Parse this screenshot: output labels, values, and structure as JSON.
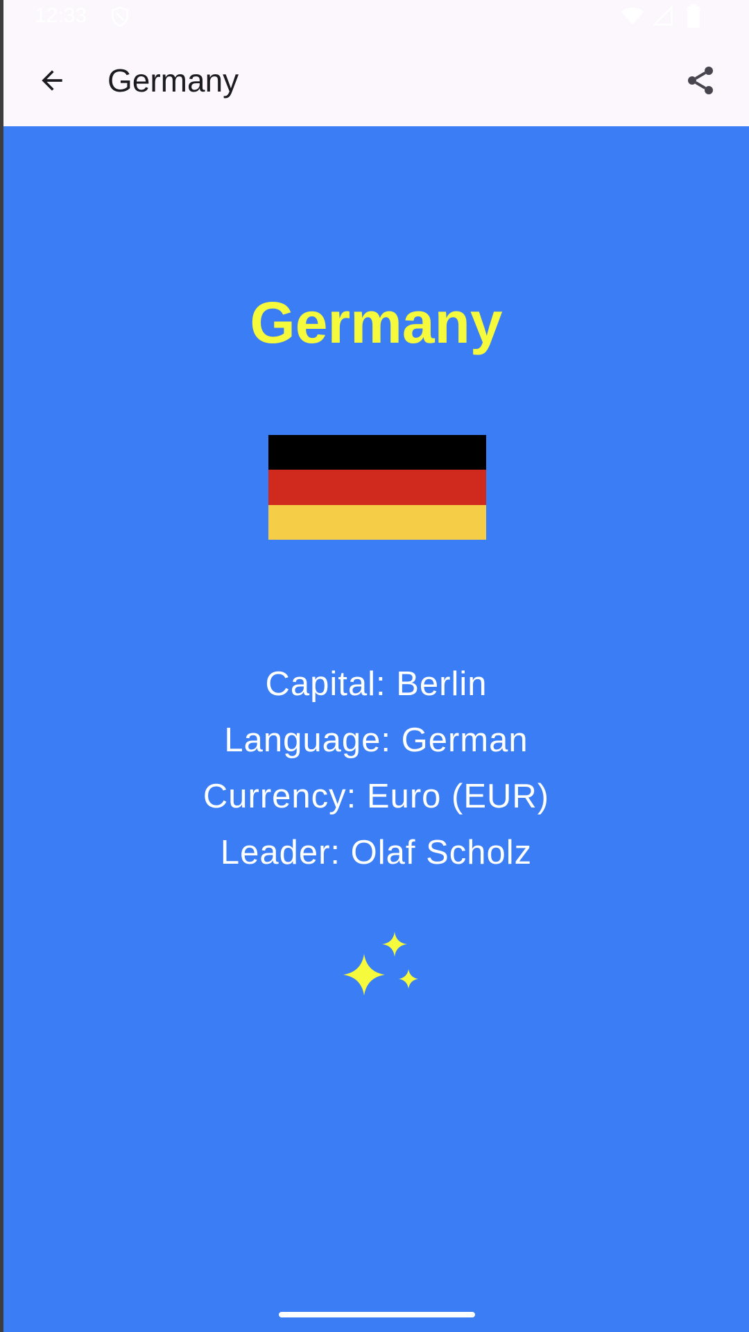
{
  "status_bar": {
    "time": "12:33",
    "icons": [
      "shield-icon",
      "wifi-icon",
      "signal-icon",
      "battery-icon"
    ]
  },
  "app_bar": {
    "back_icon": "arrow-back-icon",
    "title": "Germany",
    "share_icon": "share-icon"
  },
  "country": {
    "name": "Germany",
    "flag": {
      "stripes": [
        "#000000",
        "#cf2a1d",
        "#f6cd47"
      ]
    },
    "facts": {
      "capital": "Capital: Berlin",
      "language": "Language: German",
      "currency": "Currency: Euro (EUR)",
      "leader": "Leader: Olaf Scholz"
    },
    "decoration_icon": "sparkles-icon"
  },
  "colors": {
    "background": "#3a7df5",
    "heading": "#f6fa3c",
    "app_bar": "#fbf7fd",
    "sparkles": "#f6fa3c"
  }
}
